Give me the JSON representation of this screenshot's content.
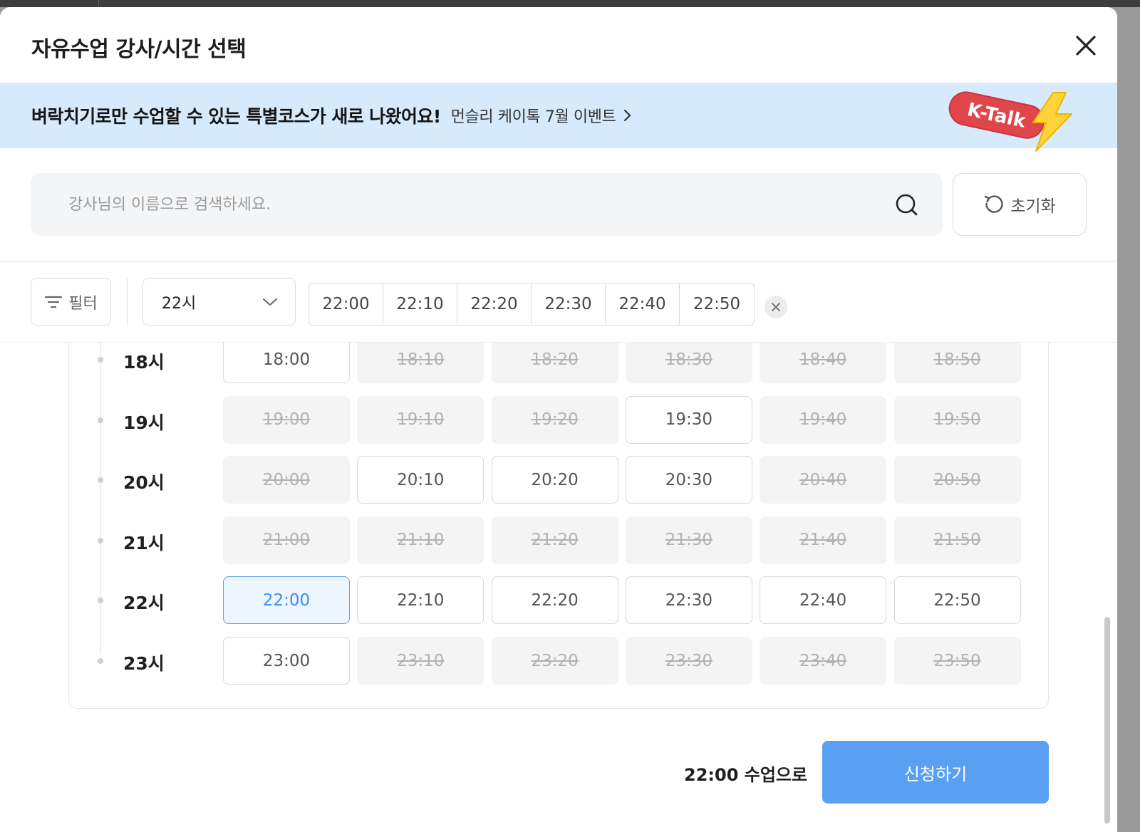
{
  "modal": {
    "title": "자유수업 강사/시간 선택"
  },
  "banner": {
    "main_text": "벼락치기로만 수업할 수 있는 특별코스가 새로 나왔어요!",
    "link_text": "먼슬리 케이톡 7월 이벤트",
    "badge_text": "K-Talk"
  },
  "search": {
    "placeholder": "강사님의 이름으로 검색하세요.",
    "value": "",
    "reset_label": "초기화"
  },
  "filter": {
    "filter_label": "필터",
    "hour_selected": "22시",
    "minute_options": [
      "22:00",
      "22:10",
      "22:20",
      "22:30",
      "22:40",
      "22:50"
    ]
  },
  "schedule": {
    "rows": [
      {
        "label": "18시",
        "slots": [
          {
            "t": "18:00",
            "s": "available"
          },
          {
            "t": "18:10",
            "s": "disabled"
          },
          {
            "t": "18:20",
            "s": "disabled"
          },
          {
            "t": "18:30",
            "s": "disabled"
          },
          {
            "t": "18:40",
            "s": "disabled"
          },
          {
            "t": "18:50",
            "s": "disabled"
          }
        ]
      },
      {
        "label": "19시",
        "slots": [
          {
            "t": "19:00",
            "s": "disabled"
          },
          {
            "t": "19:10",
            "s": "disabled"
          },
          {
            "t": "19:20",
            "s": "disabled"
          },
          {
            "t": "19:30",
            "s": "available"
          },
          {
            "t": "19:40",
            "s": "disabled"
          },
          {
            "t": "19:50",
            "s": "disabled"
          }
        ]
      },
      {
        "label": "20시",
        "slots": [
          {
            "t": "20:00",
            "s": "disabled"
          },
          {
            "t": "20:10",
            "s": "available"
          },
          {
            "t": "20:20",
            "s": "available"
          },
          {
            "t": "20:30",
            "s": "available"
          },
          {
            "t": "20:40",
            "s": "disabled"
          },
          {
            "t": "20:50",
            "s": "disabled"
          }
        ]
      },
      {
        "label": "21시",
        "slots": [
          {
            "t": "21:00",
            "s": "disabled"
          },
          {
            "t": "21:10",
            "s": "disabled"
          },
          {
            "t": "21:20",
            "s": "disabled"
          },
          {
            "t": "21:30",
            "s": "disabled"
          },
          {
            "t": "21:40",
            "s": "disabled"
          },
          {
            "t": "21:50",
            "s": "disabled"
          }
        ]
      },
      {
        "label": "22시",
        "slots": [
          {
            "t": "22:00",
            "s": "selected"
          },
          {
            "t": "22:10",
            "s": "available"
          },
          {
            "t": "22:20",
            "s": "available"
          },
          {
            "t": "22:30",
            "s": "available"
          },
          {
            "t": "22:40",
            "s": "available"
          },
          {
            "t": "22:50",
            "s": "available"
          }
        ]
      },
      {
        "label": "23시",
        "slots": [
          {
            "t": "23:00",
            "s": "available"
          },
          {
            "t": "23:10",
            "s": "disabled"
          },
          {
            "t": "23:20",
            "s": "disabled"
          },
          {
            "t": "23:30",
            "s": "disabled"
          },
          {
            "t": "23:40",
            "s": "disabled"
          },
          {
            "t": "23:50",
            "s": "disabled"
          }
        ]
      }
    ]
  },
  "footer": {
    "summary": "22:00 수업으로",
    "apply_label": "신청하기"
  },
  "colors": {
    "accent": "#5aa0f2",
    "banner_bg": "#d6eafc",
    "selected_text": "#3d8ef0",
    "badge_red": "#e0454a",
    "bolt_yellow": "#ffd43b"
  },
  "icons": [
    "close-icon",
    "chevron-right-icon",
    "search-icon",
    "refresh-icon",
    "filter-icon",
    "chevron-down-icon",
    "clear-icon",
    "lightning-icon"
  ]
}
